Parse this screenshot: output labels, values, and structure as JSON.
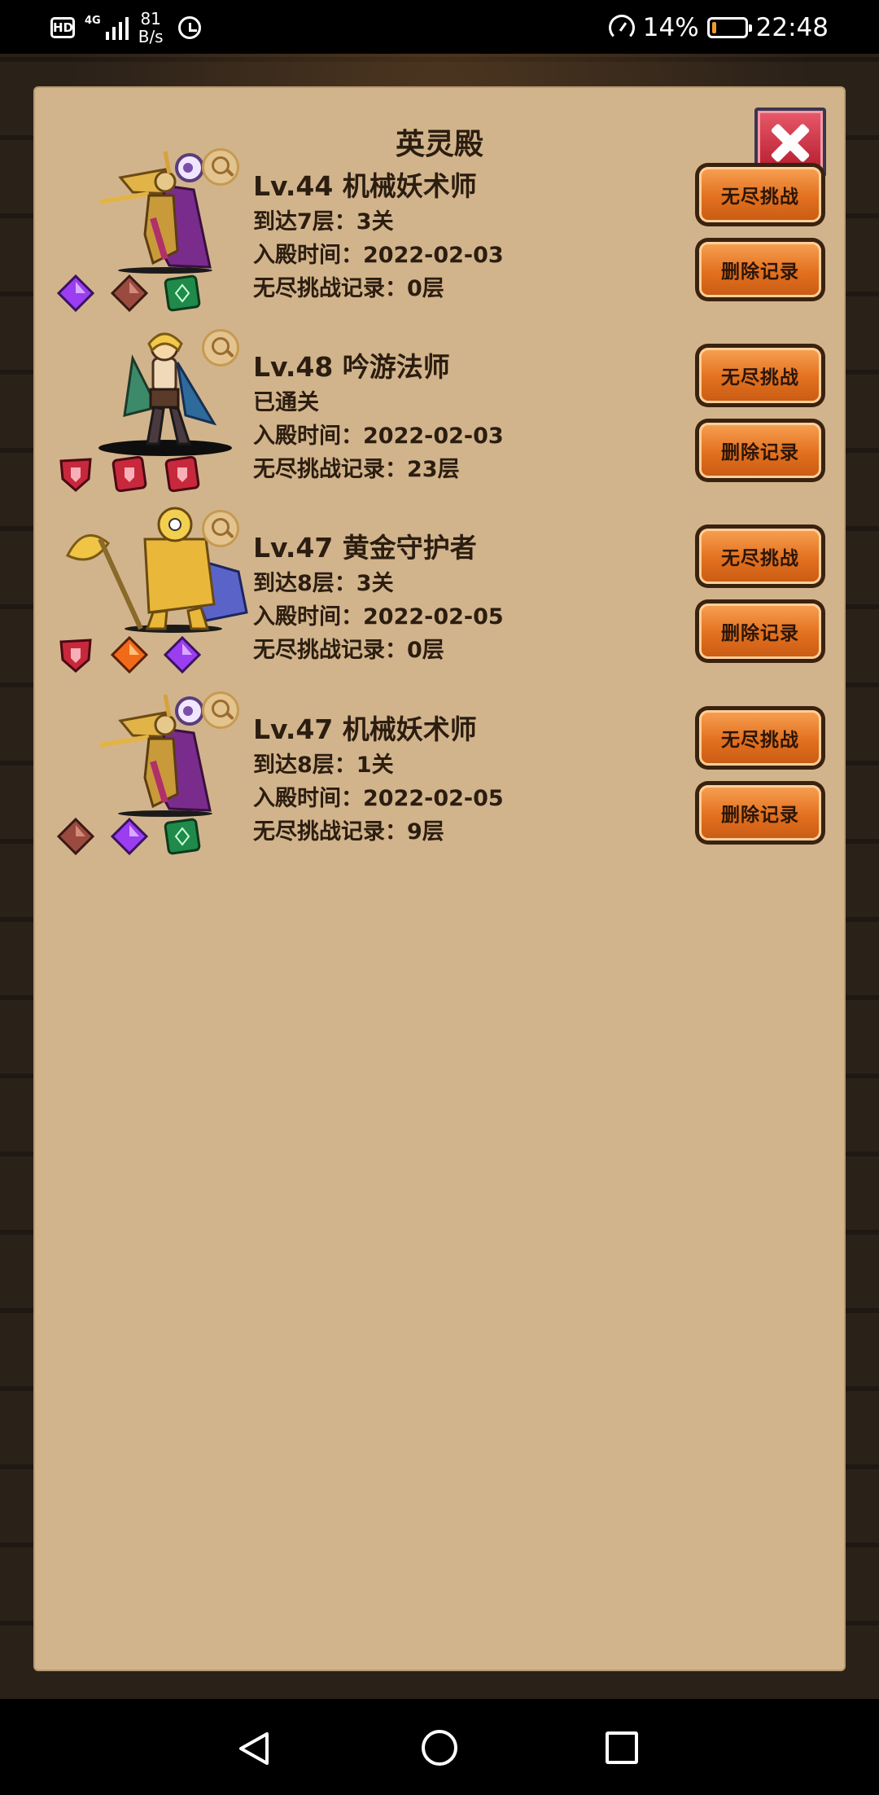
{
  "status_bar": {
    "hd": "HD",
    "network": "4G",
    "speed_value": "81",
    "speed_unit": "B/s",
    "battery_percent": "14%",
    "battery_level": 0.14,
    "time": "22:48"
  },
  "dialog": {
    "title": "英灵殿",
    "close_icon": "close-x-icon"
  },
  "heroes": [
    {
      "name": "Lv.44 机械妖术师",
      "progress": "到达7层：3关",
      "entry_date": "入殿时间：2022-02-03",
      "endless_record": "无尽挑战记录：0层",
      "portrait": "mechanical-sorcerer",
      "gems": [
        "purple-diamond",
        "brown-diamond",
        "green-square"
      ],
      "challenge_label": "无尽挑战",
      "delete_label": "删除记录"
    },
    {
      "name": "Lv.48 吟游法师",
      "progress": "已通关",
      "entry_date": "入殿时间：2022-02-03",
      "endless_record": "无尽挑战记录：23层",
      "portrait": "bard-mage",
      "gems": [
        "red-shield",
        "red-square",
        "red-square"
      ],
      "challenge_label": "无尽挑战",
      "delete_label": "删除记录"
    },
    {
      "name": "Lv.47 黄金守护者",
      "progress": "到达8层：3关",
      "entry_date": "入殿时间：2022-02-05",
      "endless_record": "无尽挑战记录：0层",
      "portrait": "golden-guardian",
      "gems": [
        "red-shield",
        "orange-diamond",
        "purple-diamond"
      ],
      "challenge_label": "无尽挑战",
      "delete_label": "删除记录"
    },
    {
      "name": "Lv.47 机械妖术师",
      "progress": "到达8层：1关",
      "entry_date": "入殿时间：2022-02-05",
      "endless_record": "无尽挑战记录：9层",
      "portrait": "mechanical-sorcerer",
      "gems": [
        "brown-diamond",
        "purple-diamond",
        "green-square"
      ],
      "challenge_label": "无尽挑战",
      "delete_label": "删除记录"
    }
  ],
  "colors": {
    "panel": "#d2b48c",
    "button": "#e2701f",
    "close": "#c8283c",
    "text": "#2b1d10"
  },
  "nav_bar": {
    "back_icon": "back-triangle-icon",
    "home_icon": "home-circle-icon",
    "recent_icon": "recent-square-icon"
  }
}
